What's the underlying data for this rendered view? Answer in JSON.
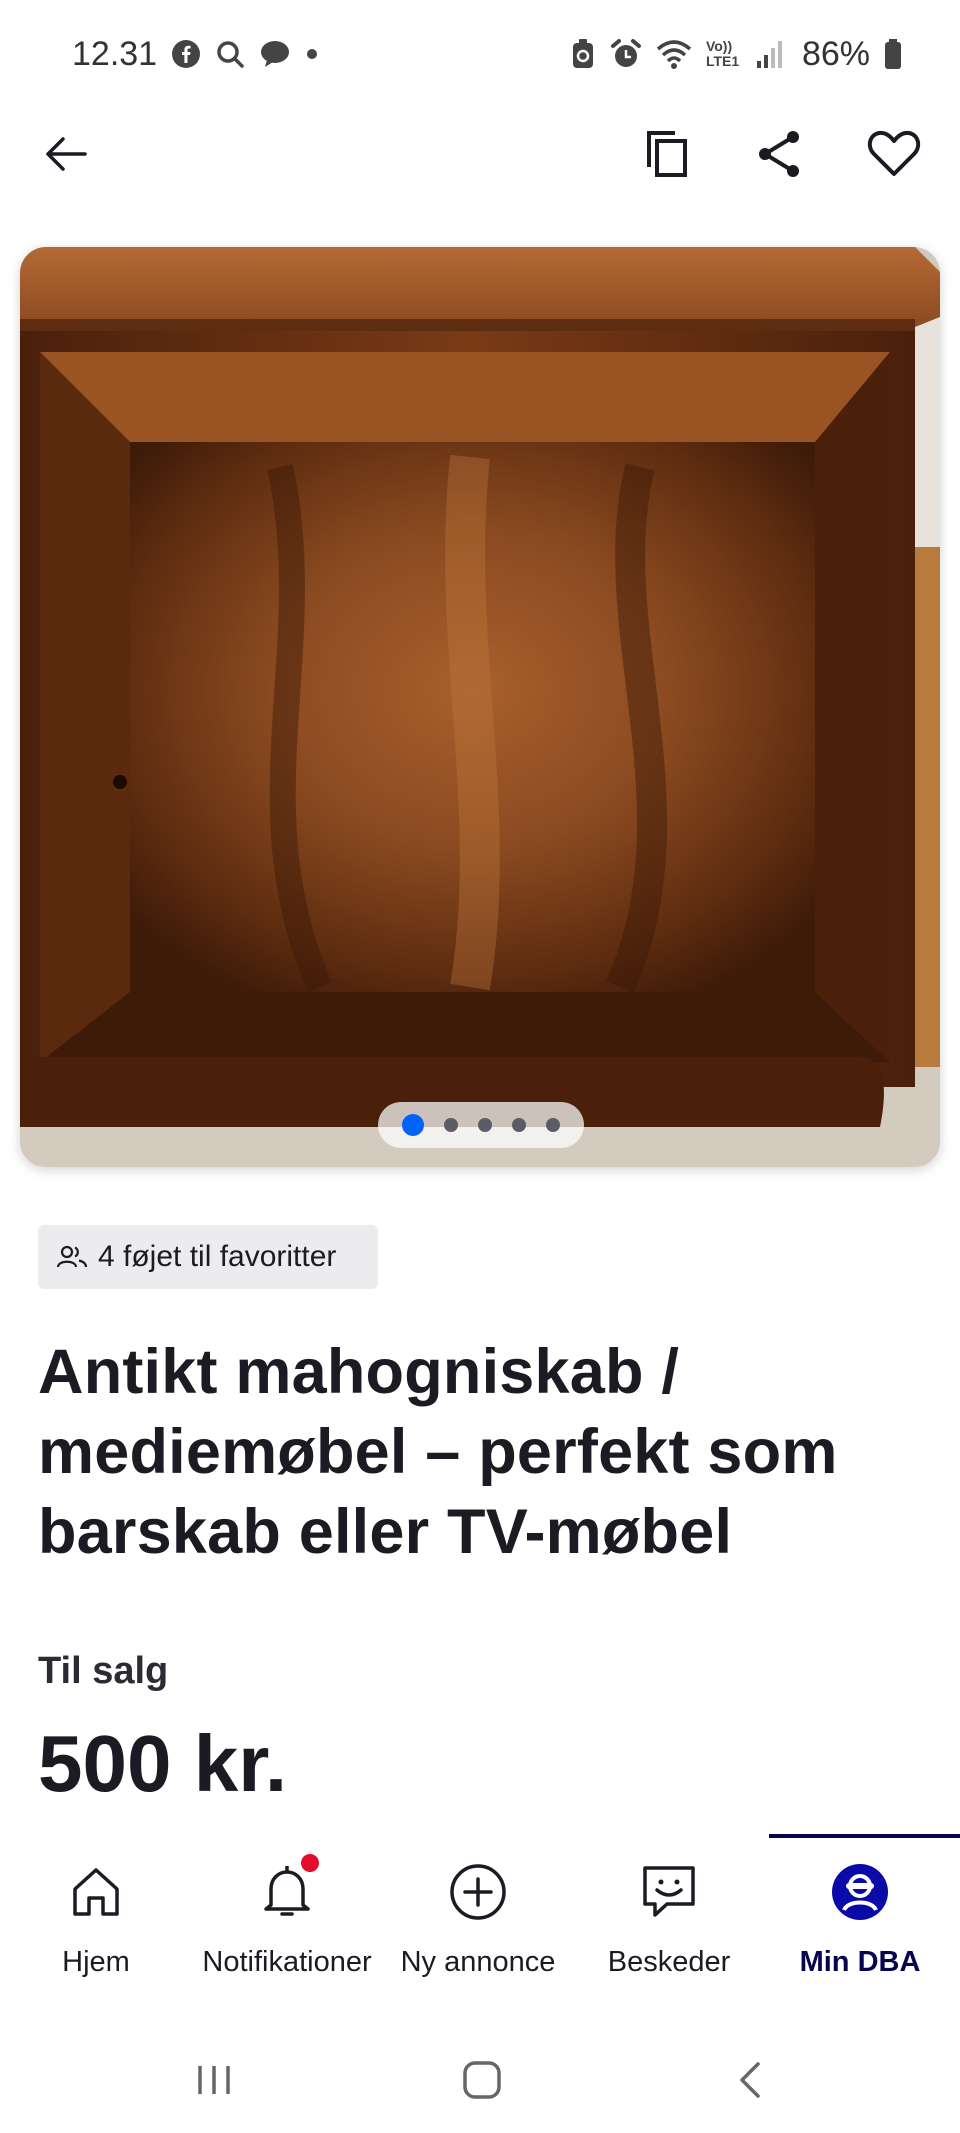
{
  "status_bar": {
    "time": "12.31",
    "left_icons": [
      "facebook-icon",
      "search-icon",
      "messenger-icon",
      "dot-icon"
    ],
    "right_icons": [
      "battery-saver-icon",
      "alarm-icon",
      "wifi-icon",
      "volte-icon",
      "signal-icon",
      "battery-icon"
    ],
    "volte_text": "Vo)) LTE1",
    "battery": "86%"
  },
  "top_nav": {
    "icons": [
      "back-arrow-icon",
      "copy-icon",
      "share-icon",
      "heart-icon"
    ]
  },
  "gallery": {
    "image_count": 5,
    "active_index": 0,
    "accent_color": "#0063fb"
  },
  "favorites": {
    "text": "4 føjet til favoritter",
    "icon": "users-icon"
  },
  "listing": {
    "title": "Antikt mahogniskab / mediemøbel – perfekt som barskab eller TV-møbel",
    "status": "Til salg",
    "price": "500 kr."
  },
  "bottom_nav": {
    "items": [
      {
        "label": "Hjem",
        "icon": "home-icon"
      },
      {
        "label": "Notifikationer",
        "icon": "bell-icon"
      },
      {
        "label": "Ny annonce",
        "icon": "plus-circle-icon"
      },
      {
        "label": "Beskeder",
        "icon": "chat-icon"
      },
      {
        "label": "Min DBA",
        "icon": "profile-icon",
        "active": true
      }
    ],
    "active_color": "#06064e"
  },
  "system_nav": {
    "icons": [
      "recents-icon",
      "home-button-icon",
      "system-back-icon"
    ]
  }
}
